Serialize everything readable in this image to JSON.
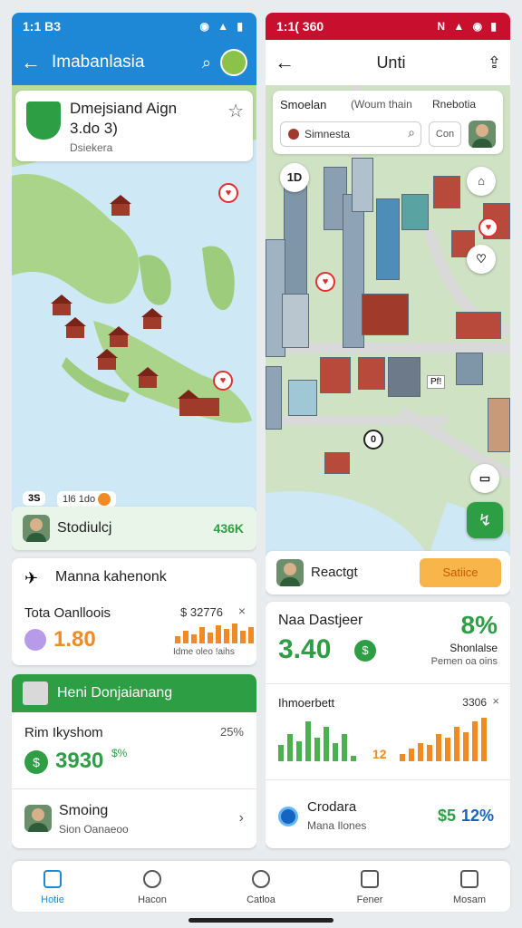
{
  "colors": {
    "left_primary": "#1e88d6",
    "right_primary": "#c8102e",
    "green": "#2e9e44",
    "orange": "#f08a24",
    "sea": "#cfe8f5",
    "land": "#a9d48a"
  },
  "left": {
    "status": {
      "time": "1:1 B3",
      "icons": "wifi-icon signal-icon battery-icon"
    },
    "appbar": {
      "title": "Imabanlasia"
    },
    "location_card": {
      "title": "Dmejsiand Aign",
      "subtitle": "3.do 3)",
      "caption": "Dsiekera"
    },
    "map_chips": {
      "chip1": "3S",
      "chip2": "1l6 1do"
    },
    "status_row": {
      "label": "Stodiulcj",
      "value": "436K"
    },
    "manage_card": {
      "title": "Manna kahenonk",
      "metric_label": "Tota Oanlloois",
      "metric_value": "1.80",
      "metric_right": "$ 32776",
      "metric_caption": "Idme oleo !aihs"
    },
    "green_card": {
      "header": "Heni Donjaianang",
      "row1_label": "Rim Ikyshom",
      "row1_pct": "25%",
      "row1_value": "3930",
      "row1_delta": "$%",
      "row2_title": "Smoing",
      "row2_caption": "Sion Oanaeoo"
    }
  },
  "right": {
    "status": {
      "time": "1:1( 360",
      "icons": "nfc-icon signal-icon wifi-icon battery-icon"
    },
    "appbar": {
      "title": "Unti"
    },
    "filters": {
      "left": "Smoelan",
      "mid": "(Woum thain",
      "right": "Rnebotia"
    },
    "search": {
      "value": "Simnesta",
      "button": "Con"
    },
    "map_labels": {
      "top_btn": "1D",
      "pin_label": "0",
      "road_label": "Pf!"
    },
    "status_row": {
      "label": "Reactgt",
      "action": "Satiice"
    },
    "stats_card": {
      "title": "Naa Dastjeer",
      "pct": "8%",
      "value": "3.40",
      "pct_caption": "Shonlalse",
      "pct_sub": "Pemen oa oins"
    },
    "chart_card": {
      "title": "Ihmoerbett",
      "right": "3306",
      "axis_label": "12"
    },
    "bottom_row": {
      "title": "Crodara",
      "caption": "Mana Ilones",
      "value_a": "$5",
      "value_b": "12%"
    }
  },
  "bottom_nav": [
    {
      "label": "Hotie",
      "icon": "home-icon"
    },
    {
      "label": "Hacon",
      "icon": "profile-icon"
    },
    {
      "label": "Catloa",
      "icon": "compass-icon"
    },
    {
      "label": "Fener",
      "icon": "document-icon"
    },
    {
      "label": "Mosam",
      "icon": "camera-icon"
    }
  ]
}
